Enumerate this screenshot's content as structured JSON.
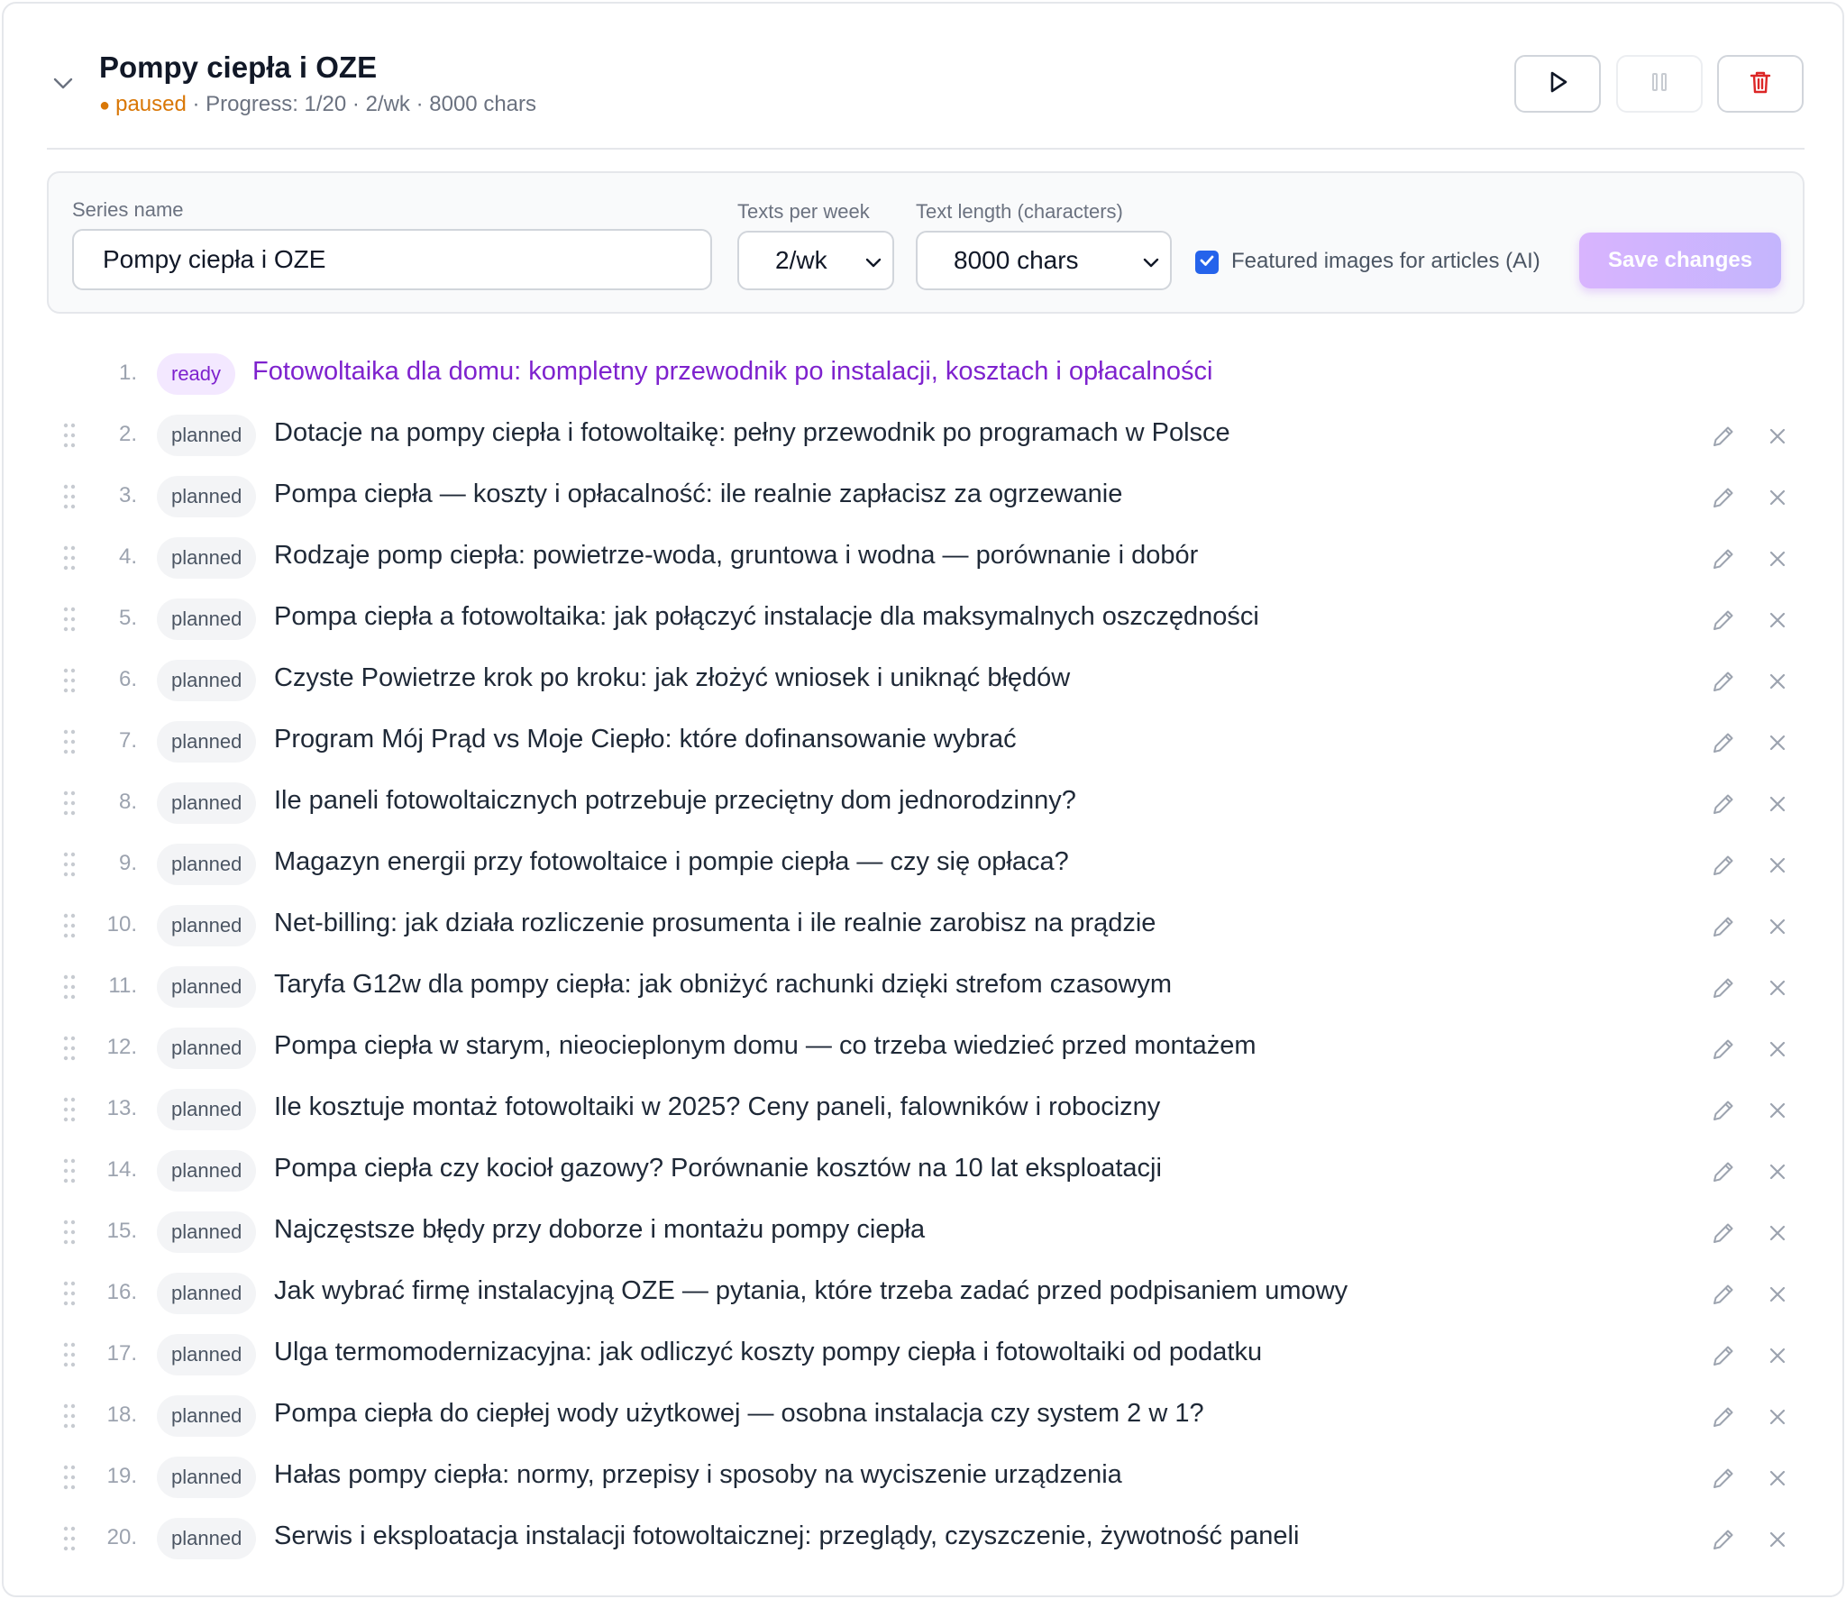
{
  "series": {
    "title": "Pompy ciepła i OZE",
    "status": "paused",
    "meta_rest": " · Progress: 1/20 · 2/wk · 8000 chars"
  },
  "header_buttons": {
    "play_icon": "play-icon",
    "pause_icon": "pause-icon",
    "delete_icon": "trash-icon"
  },
  "settings": {
    "series_name_label": "Series name",
    "series_name_value": "Pompy ciepła i OZE",
    "texts_per_week_label": "Texts per week",
    "texts_per_week_value": "2/wk",
    "text_length_label": "Text length (characters)",
    "text_length_value": "8000 chars",
    "featured_images_label": "Featured images for articles (AI)",
    "featured_images_checked": true,
    "save_label": "Save changes"
  },
  "colors": {
    "accent": "#7e22ce",
    "status_paused": "#d97706",
    "checkbox": "#2563eb",
    "delete": "#dc2626"
  },
  "items": [
    {
      "num": "1.",
      "status": "ready",
      "title": "Fotowoltaika dla domu: kompletny przewodnik po instalacji, kosztach i opłacalności"
    },
    {
      "num": "2.",
      "status": "planned",
      "title": "Dotacje na pompy ciepła i fotowoltaikę: pełny przewodnik po programach w Polsce"
    },
    {
      "num": "3.",
      "status": "planned",
      "title": "Pompa ciepła — koszty i opłacalność: ile realnie zapłacisz za ogrzewanie"
    },
    {
      "num": "4.",
      "status": "planned",
      "title": "Rodzaje pomp ciepła: powietrze-woda, gruntowa i wodna — porównanie i dobór"
    },
    {
      "num": "5.",
      "status": "planned",
      "title": "Pompa ciepła a fotowoltaika: jak połączyć instalacje dla maksymalnych oszczędności"
    },
    {
      "num": "6.",
      "status": "planned",
      "title": "Czyste Powietrze krok po kroku: jak złożyć wniosek i uniknąć błędów"
    },
    {
      "num": "7.",
      "status": "planned",
      "title": "Program Mój Prąd vs Moje Ciepło: które dofinansowanie wybrać"
    },
    {
      "num": "8.",
      "status": "planned",
      "title": "Ile paneli fotowoltaicznych potrzebuje przeciętny dom jednorodzinny?"
    },
    {
      "num": "9.",
      "status": "planned",
      "title": "Magazyn energii przy fotowoltaice i pompie ciepła — czy się opłaca?"
    },
    {
      "num": "10.",
      "status": "planned",
      "title": "Net-billing: jak działa rozliczenie prosumenta i ile realnie zarobisz na prądzie"
    },
    {
      "num": "11.",
      "status": "planned",
      "title": "Taryfa G12w dla pompy ciepła: jak obniżyć rachunki dzięki strefom czasowym"
    },
    {
      "num": "12.",
      "status": "planned",
      "title": "Pompa ciepła w starym, nieocieplonym domu — co trzeba wiedzieć przed montażem"
    },
    {
      "num": "13.",
      "status": "planned",
      "title": "Ile kosztuje montaż fotowoltaiki w 2025? Ceny paneli, falowników i robocizny"
    },
    {
      "num": "14.",
      "status": "planned",
      "title": "Pompa ciepła czy kocioł gazowy? Porównanie kosztów na 10 lat eksploatacji"
    },
    {
      "num": "15.",
      "status": "planned",
      "title": "Najczęstsze błędy przy doborze i montażu pompy ciepła"
    },
    {
      "num": "16.",
      "status": "planned",
      "title": "Jak wybrać firmę instalacyjną OZE — pytania, które trzeba zadać przed podpisaniem umowy"
    },
    {
      "num": "17.",
      "status": "planned",
      "title": "Ulga termomodernizacyjna: jak odliczyć koszty pompy ciepła i fotowoltaiki od podatku"
    },
    {
      "num": "18.",
      "status": "planned",
      "title": "Pompa ciepła do ciepłej wody użytkowej — osobna instalacja czy system 2 w 1?"
    },
    {
      "num": "19.",
      "status": "planned",
      "title": "Hałas pompy ciepła: normy, przepisy i sposoby na wyciszenie urządzenia"
    },
    {
      "num": "20.",
      "status": "planned",
      "title": "Serwis i eksploatacja instalacji fotowoltaicznej: przeglądy, czyszczenie, żywotność paneli"
    }
  ]
}
